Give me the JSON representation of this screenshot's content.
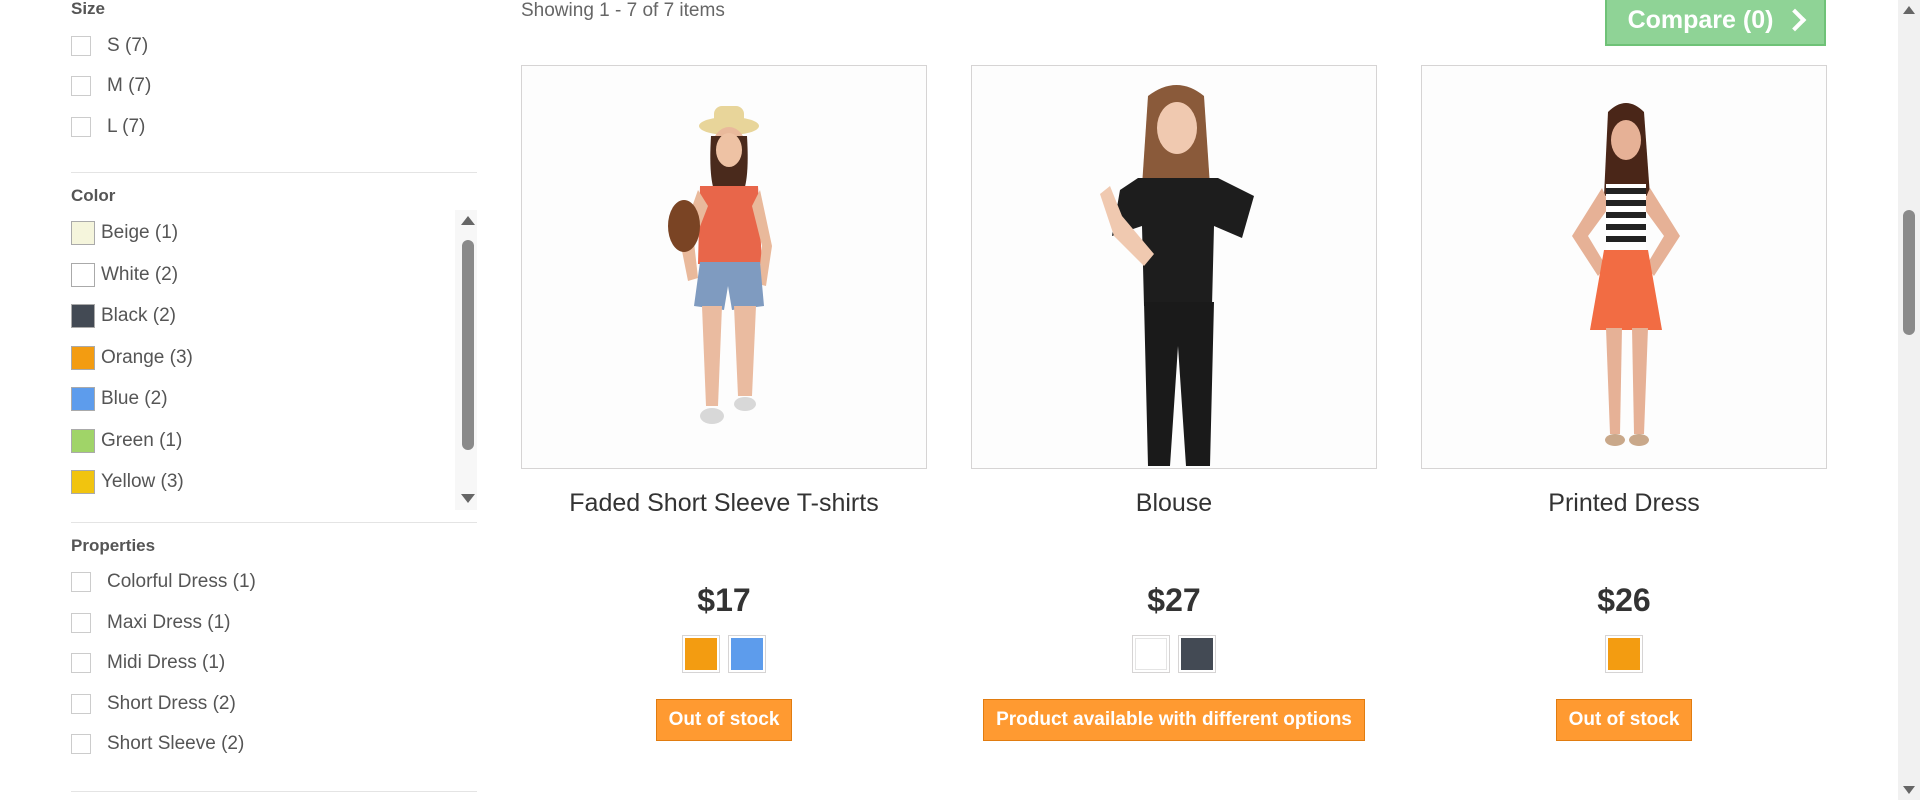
{
  "filters": {
    "size": {
      "title": "Size",
      "items": [
        {
          "label": "S (7)"
        },
        {
          "label": "M (7)"
        },
        {
          "label": "L (7)"
        }
      ]
    },
    "color": {
      "title": "Color",
      "items": [
        {
          "label": "Beige (1)",
          "swatch": "#f5f5dc"
        },
        {
          "label": "White (2)",
          "swatch": "#ffffff"
        },
        {
          "label": "Black (2)",
          "swatch": "#434a54"
        },
        {
          "label": "Orange (3)",
          "swatch": "#f39c11"
        },
        {
          "label": "Blue (2)",
          "swatch": "#5d9cec"
        },
        {
          "label": "Green (1)",
          "swatch": "#a0d468"
        },
        {
          "label": "Yellow (3)",
          "swatch": "#f1c40f"
        }
      ]
    },
    "properties": {
      "title": "Properties",
      "items": [
        {
          "label": "Colorful Dress (1)"
        },
        {
          "label": "Maxi Dress (1)"
        },
        {
          "label": "Midi Dress (1)"
        },
        {
          "label": "Short Dress (2)"
        },
        {
          "label": "Short Sleeve (2)"
        }
      ]
    }
  },
  "listing": {
    "showing_text": "Showing 1 - 7 of 7 items",
    "compare_label": "Compare (0)"
  },
  "products": [
    {
      "name": "Faded Short Sleeve T-shirts",
      "price": "$17",
      "colors": [
        "#f39c11",
        "#5d9cec"
      ],
      "availability": "Out of stock"
    },
    {
      "name": "Blouse",
      "price": "$27",
      "colors": [
        "#ffffff",
        "#434a54"
      ],
      "availability": "Product available with different options"
    },
    {
      "name": "Printed Dress",
      "price": "$26",
      "colors": [
        "#f39c11"
      ],
      "availability": "Out of stock"
    }
  ]
}
